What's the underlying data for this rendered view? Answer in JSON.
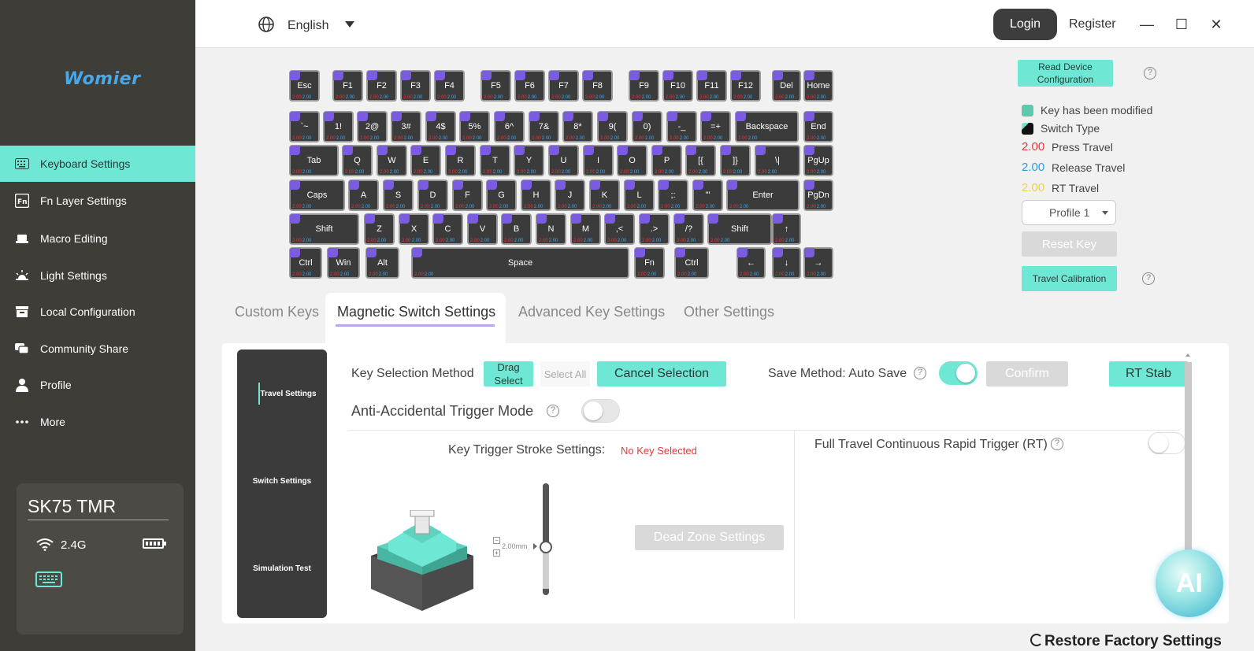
{
  "brand": {
    "logo": "Womier",
    "accent": "#6ee8d4"
  },
  "topbar": {
    "language": "English",
    "login": "Login",
    "register": "Register"
  },
  "sidebar": {
    "items": [
      {
        "label": "Keyboard Settings",
        "icon": "keyboard-icon"
      },
      {
        "label": "Fn Layer Settings",
        "icon": "fn-icon"
      },
      {
        "label": "Macro Editing",
        "icon": "macro-icon"
      },
      {
        "label": "Light Settings",
        "icon": "light-icon"
      },
      {
        "label": "Local Configuration",
        "icon": "archive-icon"
      },
      {
        "label": "Community Share",
        "icon": "community-icon"
      },
      {
        "label": "Profile",
        "icon": "user-icon"
      },
      {
        "label": "More",
        "icon": "more-icon"
      }
    ]
  },
  "device": {
    "name": "SK75 TMR",
    "connection": "2.4G"
  },
  "key_travel": {
    "press": "2.00",
    "release": "2.00"
  },
  "keyboard_rows": [
    [
      "Esc",
      "F1",
      "F2",
      "F3",
      "F4",
      "F5",
      "F6",
      "F7",
      "F8",
      "F9",
      "F10",
      "F11",
      "F12",
      "Del",
      "Home"
    ],
    [
      "`~",
      "1!",
      "2@",
      "3#",
      "4$",
      "5%",
      "6^",
      "7&",
      "8*",
      "9(",
      "0)",
      "-_",
      "=+",
      "Backspace",
      "End"
    ],
    [
      "Tab",
      "Q",
      "W",
      "E",
      "R",
      "T",
      "Y",
      "U",
      "I",
      "O",
      "P",
      "[{",
      "]}",
      "\\|",
      "PgUp"
    ],
    [
      "Caps",
      "A",
      "S",
      "D",
      "F",
      "G",
      "H",
      "J",
      "K",
      "L",
      ";:",
      "'\"",
      "Enter",
      "PgDn"
    ],
    [
      "Shift",
      "Z",
      "X",
      "C",
      "V",
      "B",
      "N",
      "M",
      ",<",
      ".>",
      "/?",
      "Shift",
      "↑"
    ],
    [
      "Ctrl",
      "Win",
      "Alt",
      "Space",
      "Fn",
      "Ctrl",
      "←",
      "↓",
      "→"
    ]
  ],
  "right_panel": {
    "read_device": "Read Device Configuration",
    "legend": {
      "modified": "Key has been modified",
      "switch_type": "Switch Type",
      "press_value": "2.00",
      "press_label": "Press Travel",
      "release_value": "2.00",
      "release_label": "Release Travel",
      "rt_value": "2.00",
      "rt_label": "RT Travel",
      "colors": {
        "press": "#e33b3b",
        "release": "#2a9fe0",
        "rt": "#f0d24a"
      }
    },
    "profile": "Profile 1",
    "reset_key": "Reset Key",
    "travel_calibration": "Travel Calibration"
  },
  "tabs": [
    "Custom Keys",
    "Magnetic Switch Settings",
    "Advanced Key Settings",
    "Other Settings"
  ],
  "subnav": [
    "Travel Settings",
    "Switch Settings",
    "Simulation Test"
  ],
  "settings": {
    "key_selection_label": "Key Selection Method",
    "drag_select": "Drag Select",
    "select_all": "Select All",
    "cancel_selection": "Cancel Selection",
    "save_method": "Save Method: Auto Save",
    "confirm": "Confirm",
    "rt_stab": "RT Stab",
    "anti_accidental": "Anti-Accidental Trigger Mode",
    "stroke_label": "Key Trigger Stroke Settings:",
    "no_key": "No Key Selected",
    "slider_value": "2.00mm",
    "dead_zone": "Dead Zone Settings",
    "full_travel_rt": "Full Travel Continuous Rapid Trigger (RT)"
  },
  "toggles": {
    "auto_save": true,
    "anti_accidental": false,
    "full_travel_rt": false
  },
  "ai_label": "AI",
  "restore": "Restore Factory Settings"
}
